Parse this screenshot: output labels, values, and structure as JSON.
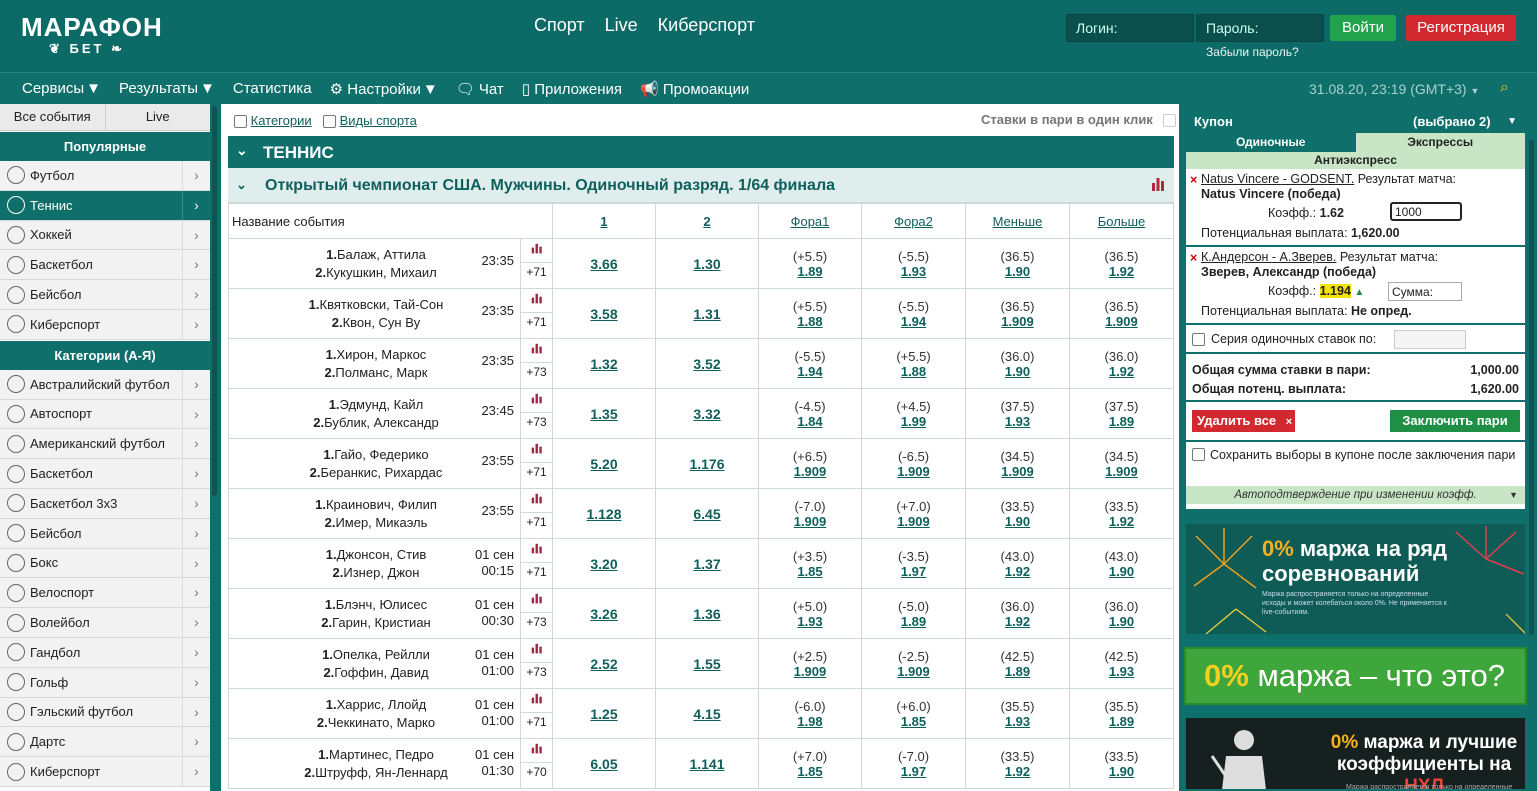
{
  "header": {
    "logo_top": "МАРАФОН",
    "logo_bottom": "БЕТ",
    "nav": [
      "Спорт",
      "Live",
      "Киберспорт"
    ],
    "login_placeholder": "Логин:",
    "password_placeholder": "Пароль:",
    "forgot": "Забыли пароль?",
    "login_button": "Войти",
    "register_button": "Регистрация"
  },
  "menu": {
    "items": [
      "Сервисы",
      "Результаты",
      "Статистика",
      "Настройки",
      "Чат",
      "Приложения",
      "Промоакции"
    ],
    "datetime": "31.08.20, 23:19 (GMT+3)"
  },
  "sidebar": {
    "tabs": [
      "Все события",
      "Live"
    ],
    "popular_title": "Популярные",
    "popular": [
      "Футбол",
      "Теннис",
      "Хоккей",
      "Баскетбол",
      "Бейсбол",
      "Киберспорт"
    ],
    "categories_title": "Категории (А-Я)",
    "categories": [
      "Австралийский футбол",
      "Автоспорт",
      "Американский футбол",
      "Баскетбол",
      "Баскетбол 3x3",
      "Бейсбол",
      "Бокс",
      "Велоспорт",
      "Волейбол",
      "Гандбол",
      "Гольф",
      "Гэльский футбол",
      "Дартс",
      "Киберспорт"
    ]
  },
  "main": {
    "filter_categories": "Категории",
    "filter_sports": "Виды спорта",
    "one_click": "Ставки в пари в один клик",
    "sport": "ТЕННИС",
    "competition": "Открытый чемпионат США. Мужчины. Одиночный разряд. 1/64 финала",
    "columns": [
      "Название события",
      "1",
      "2",
      "Фора1",
      "Фора2",
      "Меньше",
      "Больше"
    ],
    "events": [
      {
        "p1": "Балаж, Аттила",
        "p2": "Кукушкин, Михаил",
        "date": "",
        "time": "23:35",
        "more": "+71",
        "o1": "3.66",
        "o2": "1.30",
        "f1v": "(+5.5)",
        "f1": "1.89",
        "f2v": "(-5.5)",
        "f2": "1.93",
        "lv": "(36.5)",
        "l": "1.90",
        "mv": "(36.5)",
        "m": "1.92"
      },
      {
        "p1": "Квятковски, Тай-Сон",
        "p2": "Квон, Сун Ву",
        "date": "",
        "time": "23:35",
        "more": "+71",
        "o1": "3.58",
        "o2": "1.31",
        "f1v": "(+5.5)",
        "f1": "1.88",
        "f2v": "(-5.5)",
        "f2": "1.94",
        "lv": "(36.5)",
        "l": "1.909",
        "mv": "(36.5)",
        "m": "1.909"
      },
      {
        "p1": "Хирон, Маркос",
        "p2": "Полманс, Марк",
        "date": "",
        "time": "23:35",
        "more": "+73",
        "o1": "1.32",
        "o2": "3.52",
        "f1v": "(-5.5)",
        "f1": "1.94",
        "f2v": "(+5.5)",
        "f2": "1.88",
        "lv": "(36.0)",
        "l": "1.90",
        "mv": "(36.0)",
        "m": "1.92"
      },
      {
        "p1": "Эдмунд, Кайл",
        "p2": "Бублик, Александр",
        "date": "",
        "time": "23:45",
        "more": "+73",
        "o1": "1.35",
        "o2": "3.32",
        "f1v": "(-4.5)",
        "f1": "1.84",
        "f2v": "(+4.5)",
        "f2": "1.99",
        "lv": "(37.5)",
        "l": "1.93",
        "mv": "(37.5)",
        "m": "1.89"
      },
      {
        "p1": "Гайо, Федерико",
        "p2": "Беранкис, Рихардас",
        "date": "",
        "time": "23:55",
        "more": "+71",
        "o1": "5.20",
        "o2": "1.176",
        "f1v": "(+6.5)",
        "f1": "1.909",
        "f2v": "(-6.5)",
        "f2": "1.909",
        "lv": "(34.5)",
        "l": "1.909",
        "mv": "(34.5)",
        "m": "1.909"
      },
      {
        "p1": "Краинович, Филип",
        "p2": "Имер, Микаэль",
        "date": "",
        "time": "23:55",
        "more": "+71",
        "o1": "1.128",
        "o2": "6.45",
        "f1v": "(-7.0)",
        "f1": "1.909",
        "f2v": "(+7.0)",
        "f2": "1.909",
        "lv": "(33.5)",
        "l": "1.90",
        "mv": "(33.5)",
        "m": "1.92"
      },
      {
        "p1": "Джонсон, Стив",
        "p2": "Изнер, Джон",
        "date": "01 сен",
        "time": "00:15",
        "more": "+71",
        "o1": "3.20",
        "o2": "1.37",
        "f1v": "(+3.5)",
        "f1": "1.85",
        "f2v": "(-3.5)",
        "f2": "1.97",
        "lv": "(43.0)",
        "l": "1.92",
        "mv": "(43.0)",
        "m": "1.90"
      },
      {
        "p1": "Блэнч, Юлисес",
        "p2": "Гарин, Кристиан",
        "date": "01 сен",
        "time": "00:30",
        "more": "+73",
        "o1": "3.26",
        "o2": "1.36",
        "f1v": "(+5.0)",
        "f1": "1.93",
        "f2v": "(-5.0)",
        "f2": "1.89",
        "lv": "(36.0)",
        "l": "1.92",
        "mv": "(36.0)",
        "m": "1.90"
      },
      {
        "p1": "Опелка, Рейлли",
        "p2": "Гоффин, Давид",
        "date": "01 сен",
        "time": "01:00",
        "more": "+73",
        "o1": "2.52",
        "o2": "1.55",
        "f1v": "(+2.5)",
        "f1": "1.909",
        "f2v": "(-2.5)",
        "f2": "1.909",
        "lv": "(42.5)",
        "l": "1.89",
        "mv": "(42.5)",
        "m": "1.93"
      },
      {
        "p1": "Харрис, Ллойд",
        "p2": "Чеккинато, Марко",
        "date": "01 сен",
        "time": "01:00",
        "more": "+71",
        "o1": "1.25",
        "o2": "4.15",
        "f1v": "(-6.0)",
        "f1": "1.98",
        "f2v": "(+6.0)",
        "f2": "1.85",
        "lv": "(35.5)",
        "l": "1.93",
        "mv": "(35.5)",
        "m": "1.89"
      },
      {
        "p1": "Мартинес, Педро",
        "p2": "Штруфф, Ян-Леннард",
        "date": "01 сен",
        "time": "01:30",
        "more": "+70",
        "o1": "6.05",
        "o2": "1.141",
        "f1v": "(+7.0)",
        "f1": "1.85",
        "f2v": "(-7.0)",
        "f2": "1.97",
        "lv": "(33.5)",
        "l": "1.92",
        "mv": "(33.5)",
        "m": "1.90"
      }
    ]
  },
  "coupon": {
    "title": "Купон",
    "selected": "(выбрано 2)",
    "tab_single": "Одиночные",
    "tab_express": "Экспрессы",
    "anti": "Антиэкспресс",
    "bets": [
      {
        "match": "Natus Vincere - GODSENT.",
        "market": " Результат матча:",
        "outcome": "Natus Vincere (победа)",
        "coef_label": "Коэфф.:",
        "coef": "1.62",
        "stake": "1000",
        "payout_label": "Потенциальная выплата:",
        "payout": "1,620.00"
      },
      {
        "match": "К.Андерсон - А.Зверев.",
        "market": " Результат матча:",
        "outcome": "Зверев, Александр (победа)",
        "coef_label": "Коэфф.:",
        "coef": "1.194",
        "stake_placeholder": "Сумма:",
        "payout_label": "Потенциальная выплата:",
        "payout": "Не опред."
      }
    ],
    "series_label": "Серия одиночных ставок по:",
    "total_stake_label": "Общая сумма ставки в пари:",
    "total_stake": "1,000.00",
    "total_payout_label": "Общая потенц. выплата:",
    "total_payout": "1,620.00",
    "delete_all": "Удалить все",
    "place_bet": "Заключить пари",
    "save_label": "Сохранить выборы в купоне после заключения пари",
    "auto_confirm": "Автоподтверждение при изменении коэфф."
  },
  "banners": [
    {
      "pct": "0%",
      "text": "маржа на ряд соревнований",
      "small": "Маржа распространяется только на определенные исходы и может колебаться около 0%. Не применяется к live-событиям."
    },
    {
      "pct": "0%",
      "text": "маржа – что это?"
    },
    {
      "pct": "0%",
      "text": "маржа и лучшие коэффициенты на",
      "highlight": "НХЛ",
      "small": "Маржа распространяется только на определенные"
    }
  ],
  "colors": {
    "brand": "#0f6f6b",
    "accent_red": "#d22830",
    "accent_green": "#22a34b",
    "link": "#0f5f5c"
  }
}
